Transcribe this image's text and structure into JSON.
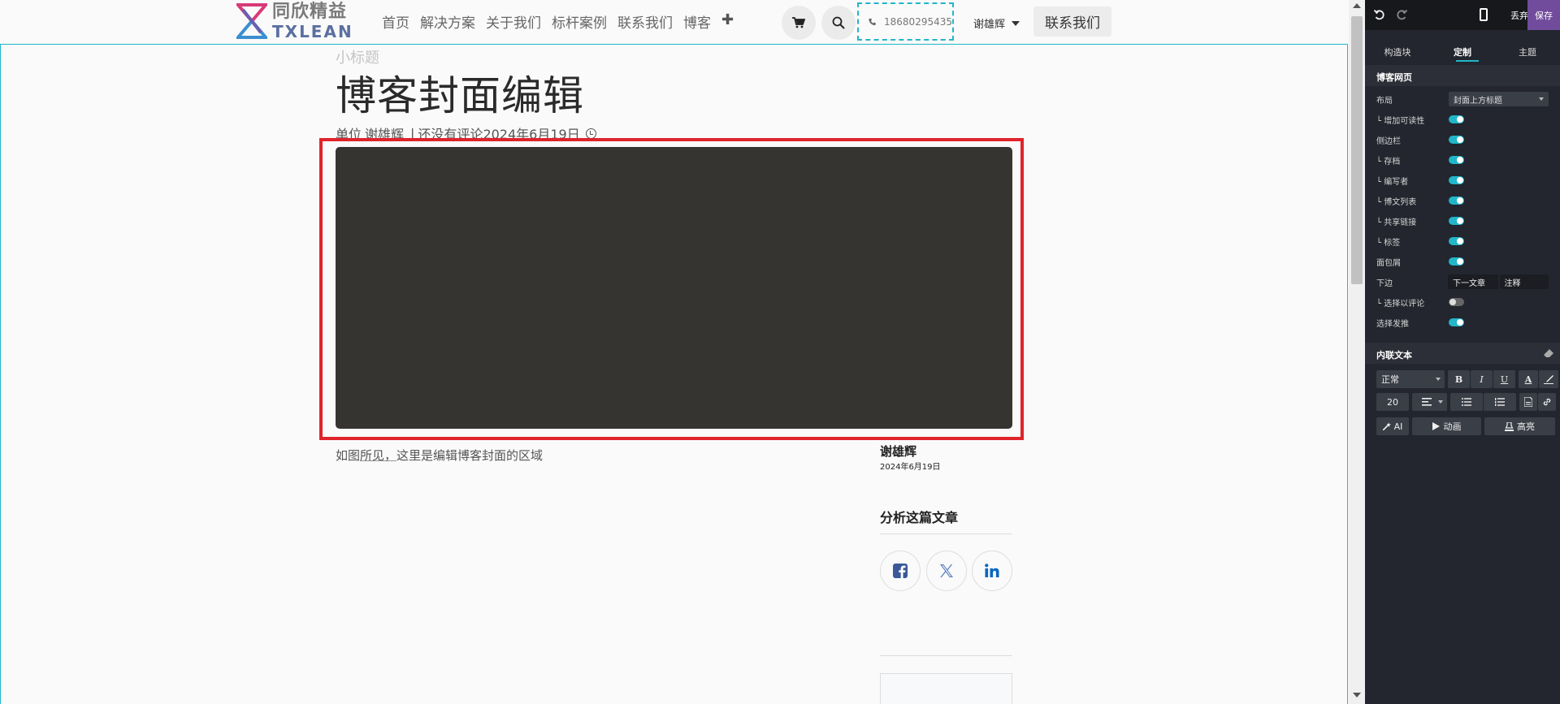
{
  "navbar": {
    "logo_cn": "同欣精益",
    "logo_en": "TXLEAN",
    "menu": [
      "首页",
      "解决方案",
      "关于我们",
      "标杆案例",
      "联系我们",
      "博客"
    ],
    "add_label": "✚",
    "phone": "18680295435",
    "user": "谢雄辉",
    "contact_button": "联系我们"
  },
  "post": {
    "subtitle": "小标题",
    "title": "博客封面编辑",
    "meta_prefix": "单位",
    "meta_author": "谢雄辉",
    "meta_sep": "|",
    "meta_comments": "还没有评论",
    "meta_date": "2024年6月19日",
    "caption_pre": "如图",
    "caption_underlined": "所见，",
    "caption_post": "这里是编辑博客封面的区域"
  },
  "sidebar": {
    "author_name": "谢雄辉",
    "author_date": "2024年6月19日",
    "share_title": "分析这篇文章"
  },
  "panel": {
    "discard": "丢弃",
    "save": "保存",
    "tabs": [
      "构造块",
      "定制",
      "主题"
    ],
    "section_blog": "博客网页",
    "options": {
      "layout_label": "布局",
      "layout_value": "封面上方标题",
      "readability": "└ 增加可读性",
      "sidebar": "侧边栏",
      "archive": "└ 存档",
      "author": "└ 编写者",
      "post_list": "└ 博文列表",
      "share_links": "└ 共享链接",
      "tags": "└ 标签",
      "breadcrumb": "面包屑",
      "bottom_label": "下边",
      "bottom_next": "下一文章",
      "bottom_comments": "注释",
      "select_comment": "└ 选择以评论",
      "select_post": "选择发推"
    },
    "section_inline": "内联文本",
    "toolbar": {
      "style": "正常",
      "bold": "B",
      "italic": "I",
      "underline": "U",
      "font_color": "A",
      "font_size": "20",
      "ai": "AI",
      "animate": "动画",
      "highlight": "高亮"
    }
  },
  "colors": {
    "accent": "#21b6c9",
    "save": "#714b9c",
    "highlight_box": "#e0242b"
  }
}
